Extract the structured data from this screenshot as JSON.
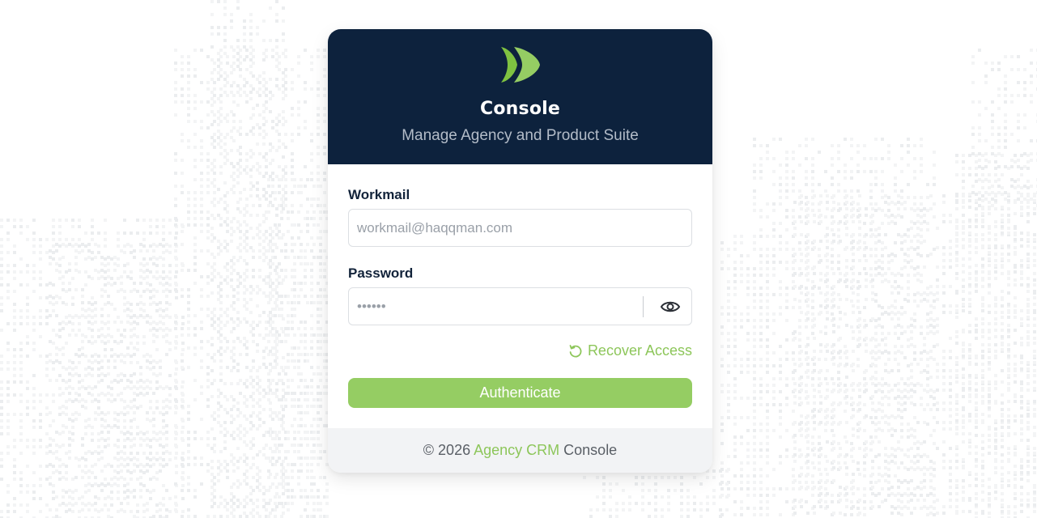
{
  "header": {
    "title": "Console",
    "subtitle": "Manage Agency and Product Suite",
    "logo_icon": "brand-chevrons-icon"
  },
  "form": {
    "workmail": {
      "label": "Workmail",
      "placeholder": "workmail@haqqman.com",
      "value": ""
    },
    "password": {
      "label": "Password",
      "placeholder": "••••••",
      "value": "",
      "toggle_icon": "eye-icon"
    },
    "recover_label": "Recover Access",
    "recover_icon": "refresh-icon",
    "submit_label": "Authenticate"
  },
  "footer": {
    "prefix": "© 2026",
    "link_text": "Agency CRM",
    "suffix": "Console"
  },
  "colors": {
    "header_bg": "#0d223d",
    "accent_green": "#95cd63",
    "link_green": "#8dc65a",
    "footer_bg": "#f2f3f5"
  }
}
